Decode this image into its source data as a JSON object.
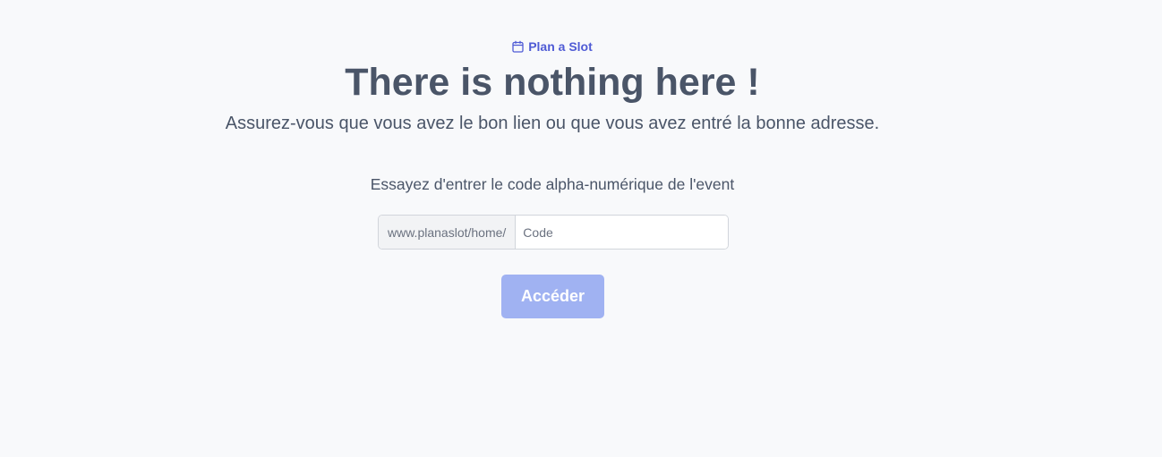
{
  "brand": {
    "icon": "calendar-icon",
    "name": "Plan a Slot",
    "color": "#4f5bd5"
  },
  "heading": {
    "title": "There is nothing here !",
    "subtitle": "Assurez-vous que vous avez le bon lien ou que vous avez entré la bonne adresse."
  },
  "form": {
    "hint": "Essayez d'entrer le code alpha-numérique de l'event",
    "prefix": "www.planaslot/home/",
    "code_value": "",
    "code_placeholder": "Code",
    "submit_label": "Accéder",
    "submit_color": "#a0b2f2"
  }
}
